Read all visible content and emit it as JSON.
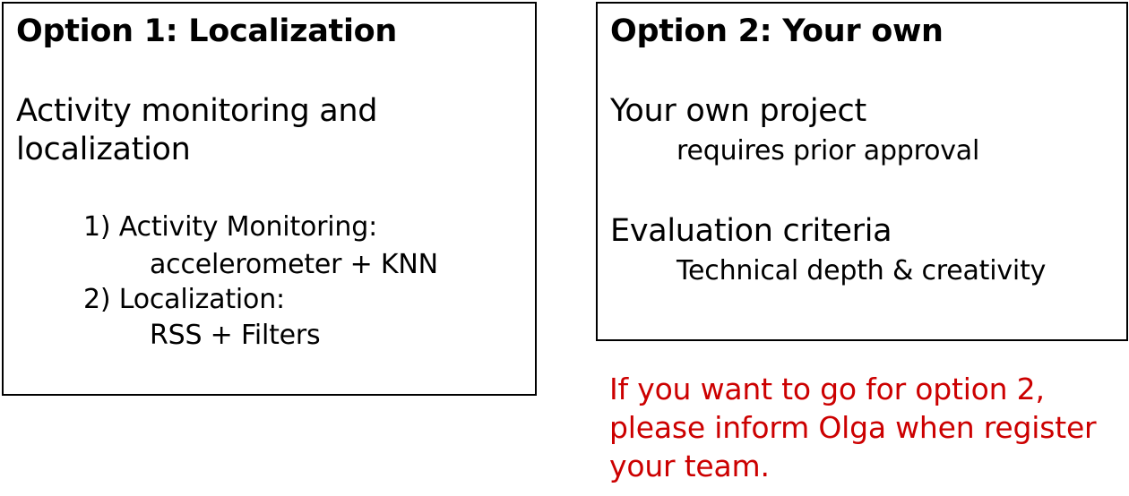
{
  "option1": {
    "title": "Option 1: Localization",
    "heading_line1": "Activity monitoring and",
    "heading_line2": "localization",
    "items": [
      {
        "label": "1) Activity Monitoring:",
        "detail": "accelerometer + KNN"
      },
      {
        "label": "2) Localization:",
        "detail": "RSS + Filters"
      }
    ]
  },
  "option2": {
    "title": "Option 2: Your own",
    "project_heading": "Your own project",
    "project_detail": "requires prior approval",
    "criteria_heading": "Evaluation criteria",
    "criteria_detail": "Technical depth & creativity"
  },
  "note": {
    "text": "If you want to go for option 2, please inform Olga when register your team.",
    "color": "#cc0000"
  }
}
